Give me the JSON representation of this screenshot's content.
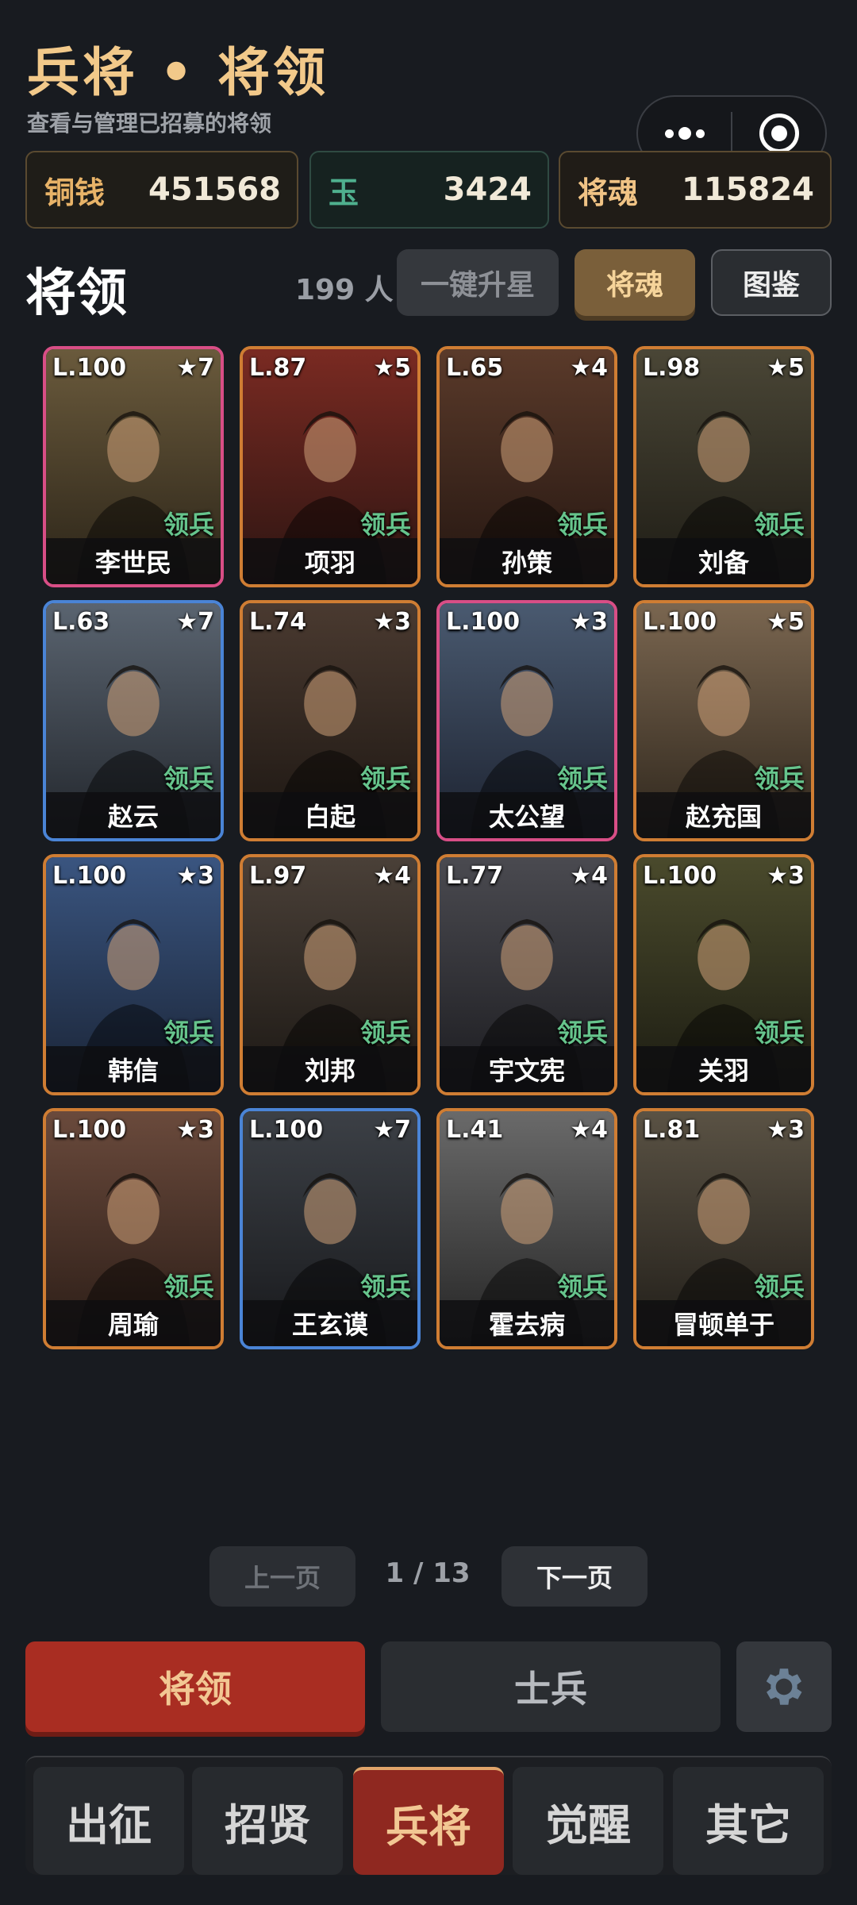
{
  "header": {
    "title": "兵将 • 将领",
    "subtitle": "查看与管理已招募的将领"
  },
  "currencies": {
    "copper": {
      "label": "铜钱",
      "value": "451568"
    },
    "jade": {
      "label": "玉",
      "value": "3424"
    },
    "soul": {
      "label": "将魂",
      "value": "115824"
    }
  },
  "section": {
    "title": "将领",
    "count": "199 人",
    "btn_star_up": "一键升星",
    "btn_soul": "将魂",
    "btn_atlas": "图鉴"
  },
  "generals": [
    {
      "name": "李世民",
      "level": "L.100",
      "stars": "★7",
      "tag": "领兵",
      "frame": "pink"
    },
    {
      "name": "项羽",
      "level": "L.87",
      "stars": "★5",
      "tag": "领兵",
      "frame": "orange"
    },
    {
      "name": "孙策",
      "level": "L.65",
      "stars": "★4",
      "tag": "领兵",
      "frame": "orange"
    },
    {
      "name": "刘备",
      "level": "L.98",
      "stars": "★5",
      "tag": "领兵",
      "frame": "orange"
    },
    {
      "name": "赵云",
      "level": "L.63",
      "stars": "★7",
      "tag": "领兵",
      "frame": "blue"
    },
    {
      "name": "白起",
      "level": "L.74",
      "stars": "★3",
      "tag": "领兵",
      "frame": "orange"
    },
    {
      "name": "太公望",
      "level": "L.100",
      "stars": "★3",
      "tag": "领兵",
      "frame": "pink"
    },
    {
      "name": "赵充国",
      "level": "L.100",
      "stars": "★5",
      "tag": "领兵",
      "frame": "orange"
    },
    {
      "name": "韩信",
      "level": "L.100",
      "stars": "★3",
      "tag": "领兵",
      "frame": "orange"
    },
    {
      "name": "刘邦",
      "level": "L.97",
      "stars": "★4",
      "tag": "领兵",
      "frame": "orange"
    },
    {
      "name": "宇文宪",
      "level": "L.77",
      "stars": "★4",
      "tag": "领兵",
      "frame": "orange"
    },
    {
      "name": "关羽",
      "level": "L.100",
      "stars": "★3",
      "tag": "领兵",
      "frame": "orange"
    },
    {
      "name": "周瑜",
      "level": "L.100",
      "stars": "★3",
      "tag": "领兵",
      "frame": "orange"
    },
    {
      "name": "王玄谟",
      "level": "L.100",
      "stars": "★7",
      "tag": "领兵",
      "frame": "blue"
    },
    {
      "name": "霍去病",
      "level": "L.41",
      "stars": "★4",
      "tag": "领兵",
      "frame": "orange"
    },
    {
      "name": "冒顿单于",
      "level": "L.81",
      "stars": "★3",
      "tag": "领兵",
      "frame": "orange"
    }
  ],
  "pagination": {
    "prev": "上一页",
    "indicator": "1 / 13",
    "next": "下一页"
  },
  "subtabs": {
    "generals": "将领",
    "soldiers": "士兵",
    "settings_icon": "gear-icon"
  },
  "bottom_nav": [
    "出征",
    "招贤",
    "兵将",
    "觉醒",
    "其它"
  ],
  "bottom_nav_active": 2,
  "colors": {
    "accent_red": "#a92d22",
    "gold_text": "#f2c98a",
    "frame_pink": "#d84e86",
    "frame_blue": "#4a84d6",
    "frame_orange": "#cf7d33",
    "tag_green": "#66c48c"
  }
}
